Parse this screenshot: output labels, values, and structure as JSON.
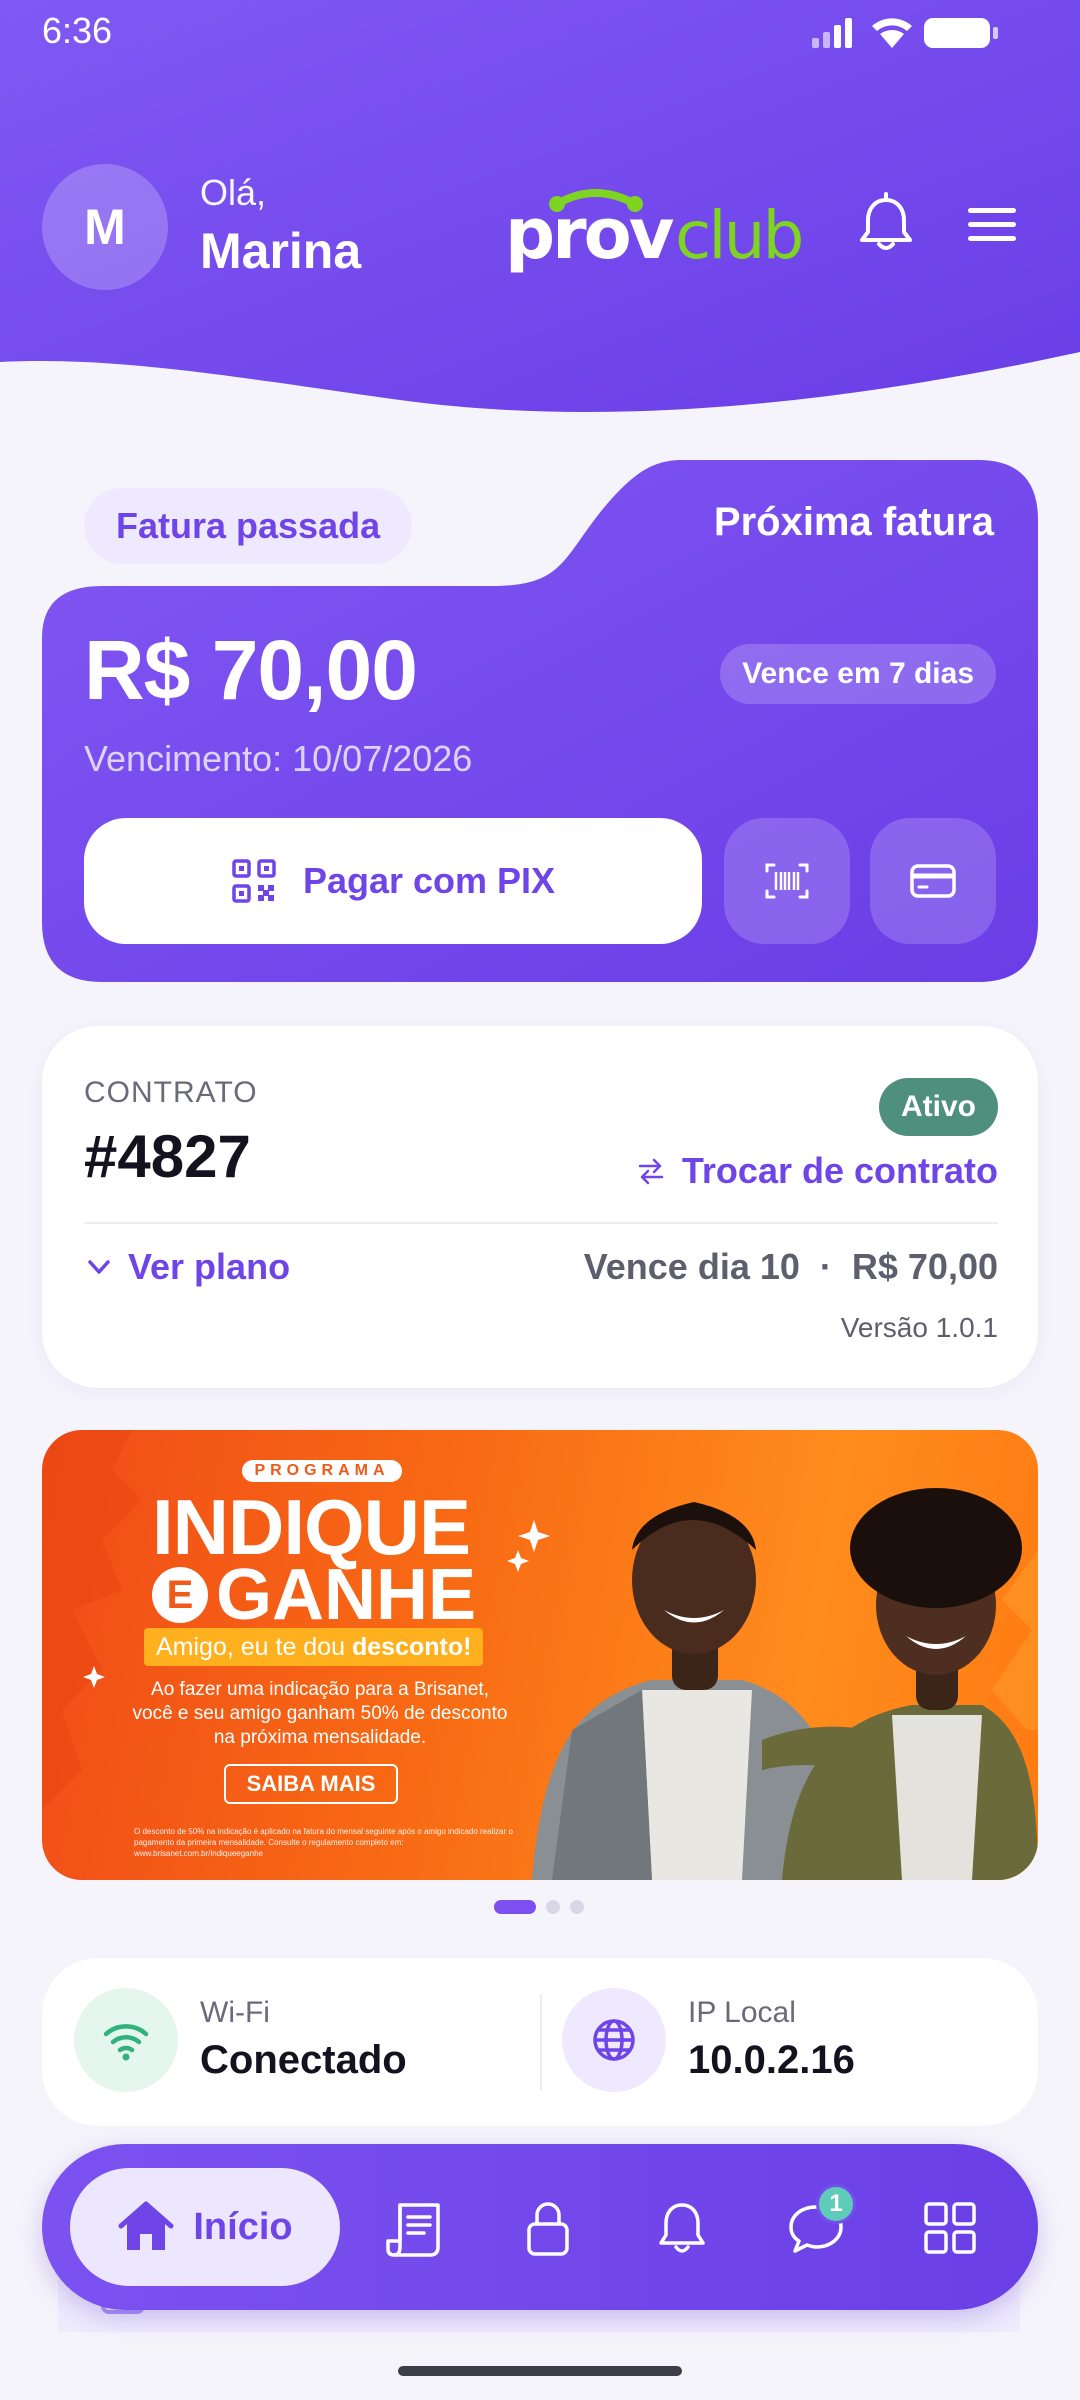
{
  "status_bar": {
    "time": "6:36"
  },
  "header": {
    "avatar_initial": "M",
    "greeting": "Olá,",
    "user_name": "Marina",
    "logo_text": "provclub"
  },
  "invoice": {
    "tab_past": "Fatura passada",
    "tab_next": "Próxima fatura",
    "amount": "R$ 70,00",
    "due_badge": "Vence em 7 dias",
    "due_date": "Vencimento: 10/07/2026",
    "pix_label": "Pagar com PIX"
  },
  "contract": {
    "label": "CONTRATO",
    "number": "#4827",
    "status": "Ativo",
    "switch_label": "Trocar de contrato",
    "plan_label": "Ver plano",
    "plan_info": "Vence dia 10  ·  R$ 70,00",
    "version": "Versão 1.0.1"
  },
  "banner": {
    "program": "PROGRAMA",
    "title_1": "INDIQUE",
    "title_e": "E",
    "title_2": "GANHE",
    "subtitle_pre": "Amigo, eu te dou ",
    "subtitle_bold": "desconto!",
    "body": "Ao fazer uma indicação para a Brisanet, você e seu amigo ganham 50% de desconto na próxima mensalidade.",
    "cta": "SAIBA MAIS",
    "fine_print": "O desconto de 50% na indicação é aplicado na fatura do mensal seguinte após o amigo indicado realizar o pagamento da primeira mensalidade. Consulte o regulamento completo em: www.brisanet.com.br/indiqueeganhe",
    "carousel_count": 3,
    "carousel_active": 0
  },
  "connection": {
    "wifi_label": "Wi-Fi",
    "wifi_value": "Conectado",
    "ip_label": "IP Local",
    "ip_value": "10.0.2.16"
  },
  "nav": {
    "home_label": "Início",
    "items": [
      "home-icon",
      "receipt-icon",
      "lock-icon",
      "bell-icon",
      "chat-icon",
      "grid-icon"
    ],
    "chat_badge": "1"
  },
  "colors": {
    "primary": "#6f45e8",
    "header_gradient_start": "#7c55f2",
    "header_gradient_end": "#6a3de6",
    "status_active": "#4f8f7d",
    "badge": "#5fcbb9",
    "logo_green": "#7fd321"
  }
}
